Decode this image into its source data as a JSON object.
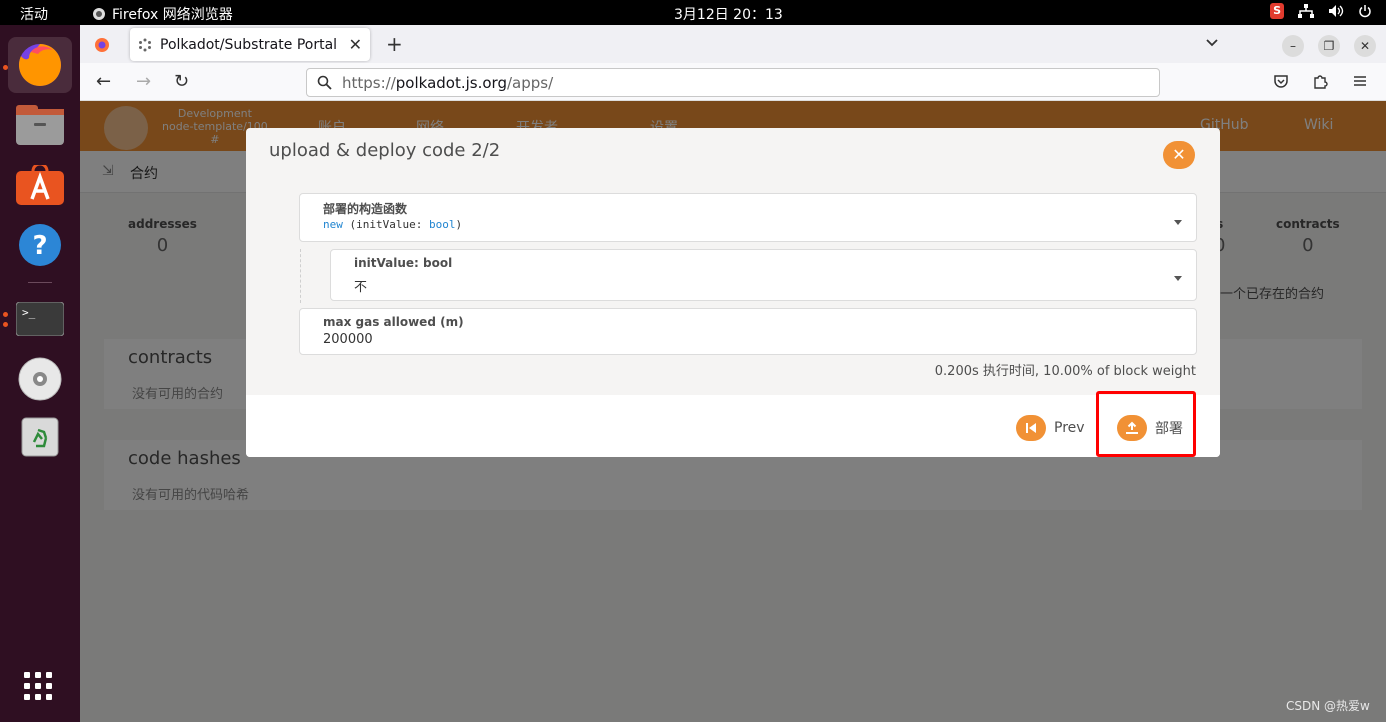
{
  "system": {
    "activities": "活动",
    "app_name": "Firefox 网络浏览器",
    "clock": "3月12日  20：13",
    "ime": "S"
  },
  "dock": {
    "items": [
      "firefox",
      "files",
      "app-center",
      "help",
      "terminal",
      "disc",
      "trash"
    ]
  },
  "browser": {
    "tab_title": "Polkadot/Substrate Portal",
    "url_scheme": "https://",
    "url_host": "polkadot.js.org",
    "url_path": "/apps/"
  },
  "app": {
    "chain_name": "Development",
    "chain_node": "node-template/100",
    "chain_block": "#",
    "menu": [
      "账户",
      "网络",
      "开发者",
      "设置"
    ],
    "links": [
      "GitHub",
      "Wiki"
    ],
    "subnav_tab": "合约",
    "summary_left_label": "addresses",
    "summary_left_value": "0",
    "summary_right_label": "contracts",
    "summary_right_value": "0",
    "summary_partial_label": "s",
    "summary_partial_value": "0",
    "side_note": "一个已存在的合约",
    "sections": [
      {
        "title": "contracts",
        "empty": "没有可用的合约"
      },
      {
        "title": "code hashes",
        "empty": "没有可用的代码哈希"
      }
    ]
  },
  "modal": {
    "title": "upload & deploy code 2/2",
    "constructor_label": "部署的构造函数",
    "constructor_kw": "new",
    "constructor_sig_open": " (initValue: ",
    "constructor_type": "bool",
    "constructor_sig_close": ")",
    "param_label": "initValue: bool",
    "param_value": "不",
    "gas_label": "max gas allowed (m)",
    "gas_value": "200000",
    "exec_info": "0.200s 执行时间, 10.00% of block weight",
    "prev_label": "Prev",
    "deploy_label": "部署"
  },
  "watermark": "CSDN @热爱w",
  "colors": {
    "accent": "#f19135",
    "highlight": "#ff0000"
  }
}
